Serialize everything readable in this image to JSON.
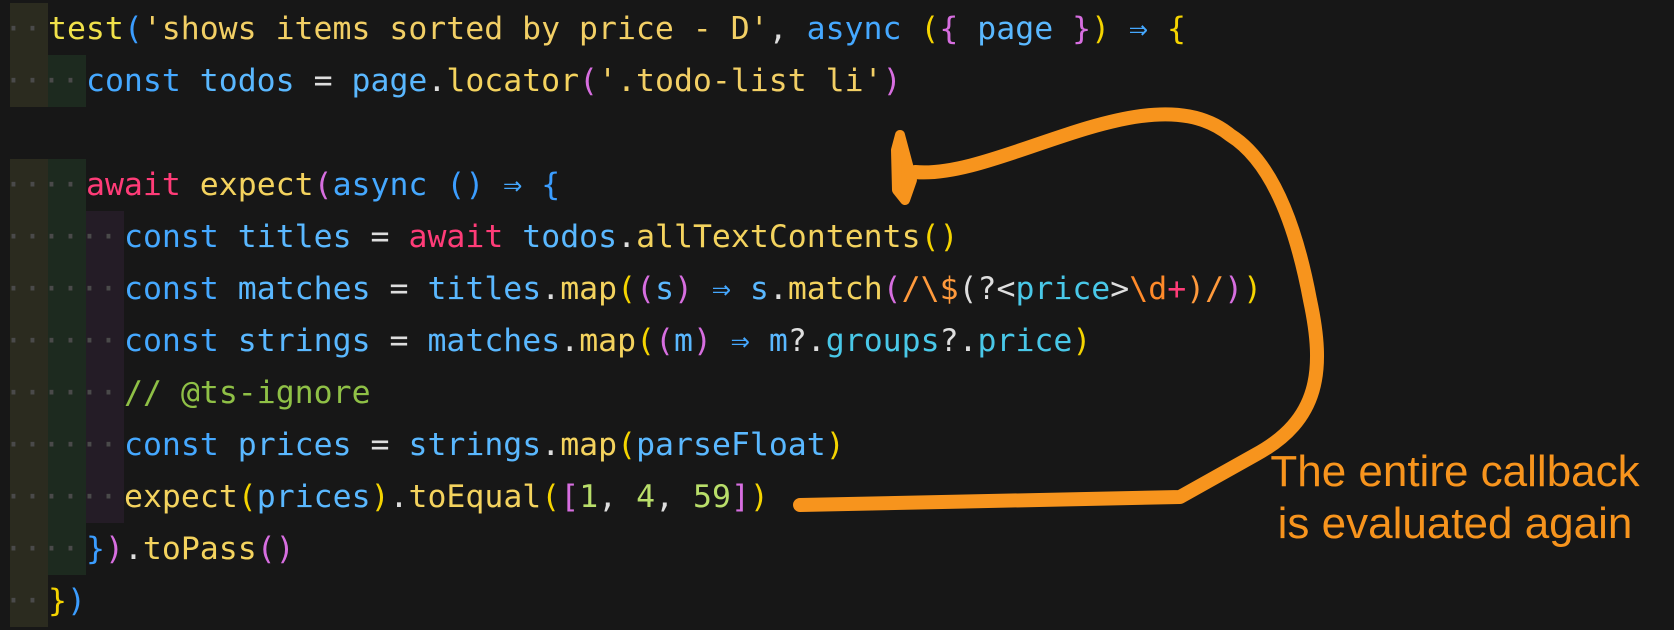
{
  "code_lines": [
    {
      "indent": 1,
      "tokens": [
        {
          "t": "test",
          "c": "t-fn2"
        },
        {
          "t": "(",
          "c": "t-b3"
        },
        {
          "t": "'shows items sorted by price - D'",
          "c": "t-str"
        },
        {
          "t": ", ",
          "c": "t-punc"
        },
        {
          "t": "async",
          "c": "t-kw"
        },
        {
          "t": " ",
          "c": "t-punc"
        },
        {
          "t": "(",
          "c": "t-b1"
        },
        {
          "t": "{",
          "c": "t-b2"
        },
        {
          "t": " page ",
          "c": "t-var"
        },
        {
          "t": "}",
          "c": "t-b2"
        },
        {
          "t": ")",
          "c": "t-b1"
        },
        {
          "t": " ⇒ ",
          "c": "t-kw"
        },
        {
          "t": "{",
          "c": "t-b1"
        }
      ]
    },
    {
      "indent": 2,
      "tokens": [
        {
          "t": "const",
          "c": "t-kw"
        },
        {
          "t": " todos ",
          "c": "t-var"
        },
        {
          "t": "= ",
          "c": "t-punc"
        },
        {
          "t": "page",
          "c": "t-var"
        },
        {
          "t": ".",
          "c": "t-punc"
        },
        {
          "t": "locator",
          "c": "t-fn"
        },
        {
          "t": "(",
          "c": "t-b2"
        },
        {
          "t": "'.todo-list li'",
          "c": "t-str"
        },
        {
          "t": ")",
          "c": "t-b2"
        }
      ]
    },
    {
      "indent": 0,
      "tokens": []
    },
    {
      "indent": 2,
      "tokens": [
        {
          "t": "await",
          "c": "t-kw2"
        },
        {
          "t": " ",
          "c": "t-punc"
        },
        {
          "t": "expect",
          "c": "t-fn"
        },
        {
          "t": "(",
          "c": "t-b2"
        },
        {
          "t": "async",
          "c": "t-kw"
        },
        {
          "t": " ",
          "c": "t-punc"
        },
        {
          "t": "()",
          "c": "t-b3"
        },
        {
          "t": " ⇒ ",
          "c": "t-kw"
        },
        {
          "t": "{",
          "c": "t-b3"
        }
      ]
    },
    {
      "indent": 3,
      "tokens": [
        {
          "t": "const",
          "c": "t-kw"
        },
        {
          "t": " titles ",
          "c": "t-var"
        },
        {
          "t": "= ",
          "c": "t-punc"
        },
        {
          "t": "await",
          "c": "t-kw2"
        },
        {
          "t": " todos",
          "c": "t-var"
        },
        {
          "t": ".",
          "c": "t-punc"
        },
        {
          "t": "allTextContents",
          "c": "t-fn"
        },
        {
          "t": "()",
          "c": "t-b1"
        }
      ]
    },
    {
      "indent": 3,
      "tokens": [
        {
          "t": "const",
          "c": "t-kw"
        },
        {
          "t": " matches ",
          "c": "t-var"
        },
        {
          "t": "= ",
          "c": "t-punc"
        },
        {
          "t": "titles",
          "c": "t-var"
        },
        {
          "t": ".",
          "c": "t-punc"
        },
        {
          "t": "map",
          "c": "t-fn"
        },
        {
          "t": "(",
          "c": "t-b1"
        },
        {
          "t": "(",
          "c": "t-b2"
        },
        {
          "t": "s",
          "c": "t-var"
        },
        {
          "t": ")",
          "c": "t-b2"
        },
        {
          "t": " ⇒ ",
          "c": "t-kw"
        },
        {
          "t": "s",
          "c": "t-var"
        },
        {
          "t": ".",
          "c": "t-punc"
        },
        {
          "t": "match",
          "c": "t-fn"
        },
        {
          "t": "(",
          "c": "t-b2"
        },
        {
          "t": "/",
          "c": "t-re"
        },
        {
          "t": "\\$",
          "c": "t-re"
        },
        {
          "t": "(?<",
          "c": "t-punc"
        },
        {
          "t": "price",
          "c": "t-prop"
        },
        {
          "t": ">",
          "c": "t-punc"
        },
        {
          "t": "\\d",
          "c": "t-op"
        },
        {
          "t": "+",
          "c": "t-kw2"
        },
        {
          "t": ")",
          "c": "t-re"
        },
        {
          "t": "/",
          "c": "t-re"
        },
        {
          "t": ")",
          "c": "t-b2"
        },
        {
          "t": ")",
          "c": "t-b1"
        }
      ]
    },
    {
      "indent": 3,
      "tokens": [
        {
          "t": "const",
          "c": "t-kw"
        },
        {
          "t": " strings ",
          "c": "t-var"
        },
        {
          "t": "= ",
          "c": "t-punc"
        },
        {
          "t": "matches",
          "c": "t-var"
        },
        {
          "t": ".",
          "c": "t-punc"
        },
        {
          "t": "map",
          "c": "t-fn"
        },
        {
          "t": "(",
          "c": "t-b1"
        },
        {
          "t": "(",
          "c": "t-b2"
        },
        {
          "t": "m",
          "c": "t-var"
        },
        {
          "t": ")",
          "c": "t-b2"
        },
        {
          "t": " ⇒ ",
          "c": "t-kw"
        },
        {
          "t": "m",
          "c": "t-var"
        },
        {
          "t": "?.",
          "c": "t-punc"
        },
        {
          "t": "groups",
          "c": "t-prop"
        },
        {
          "t": "?.",
          "c": "t-punc"
        },
        {
          "t": "price",
          "c": "t-prop"
        },
        {
          "t": ")",
          "c": "t-b1"
        }
      ]
    },
    {
      "indent": 3,
      "tokens": [
        {
          "t": "// @ts-ignore",
          "c": "t-cmt"
        }
      ]
    },
    {
      "indent": 3,
      "tokens": [
        {
          "t": "const",
          "c": "t-kw"
        },
        {
          "t": " prices ",
          "c": "t-var"
        },
        {
          "t": "= ",
          "c": "t-punc"
        },
        {
          "t": "strings",
          "c": "t-var"
        },
        {
          "t": ".",
          "c": "t-punc"
        },
        {
          "t": "map",
          "c": "t-fn"
        },
        {
          "t": "(",
          "c": "t-b1"
        },
        {
          "t": "parseFloat",
          "c": "t-var"
        },
        {
          "t": ")",
          "c": "t-b1"
        }
      ]
    },
    {
      "indent": 3,
      "tokens": [
        {
          "t": "expect",
          "c": "t-fn"
        },
        {
          "t": "(",
          "c": "t-b1"
        },
        {
          "t": "prices",
          "c": "t-var"
        },
        {
          "t": ")",
          "c": "t-b1"
        },
        {
          "t": ".",
          "c": "t-punc"
        },
        {
          "t": "toEqual",
          "c": "t-fn"
        },
        {
          "t": "(",
          "c": "t-b1"
        },
        {
          "t": "[",
          "c": "t-b2"
        },
        {
          "t": "1",
          "c": "t-num"
        },
        {
          "t": ", ",
          "c": "t-punc"
        },
        {
          "t": "4",
          "c": "t-num"
        },
        {
          "t": ", ",
          "c": "t-punc"
        },
        {
          "t": "59",
          "c": "t-num"
        },
        {
          "t": "]",
          "c": "t-b2"
        },
        {
          "t": ")",
          "c": "t-b1"
        }
      ]
    },
    {
      "indent": 2,
      "tokens": [
        {
          "t": "}",
          "c": "t-b3"
        },
        {
          "t": ")",
          "c": "t-b2"
        },
        {
          "t": ".",
          "c": "t-punc"
        },
        {
          "t": "toPass",
          "c": "t-fn"
        },
        {
          "t": "()",
          "c": "t-b2"
        }
      ]
    },
    {
      "indent": 1,
      "tokens": [
        {
          "t": "}",
          "c": "t-b1"
        },
        {
          "t": ")",
          "c": "t-b3"
        }
      ]
    }
  ],
  "annotation": {
    "line1": "The entire callback",
    "line2": "is evaluated again",
    "color": "#f7941d"
  },
  "theme": {
    "background": "#171717"
  }
}
